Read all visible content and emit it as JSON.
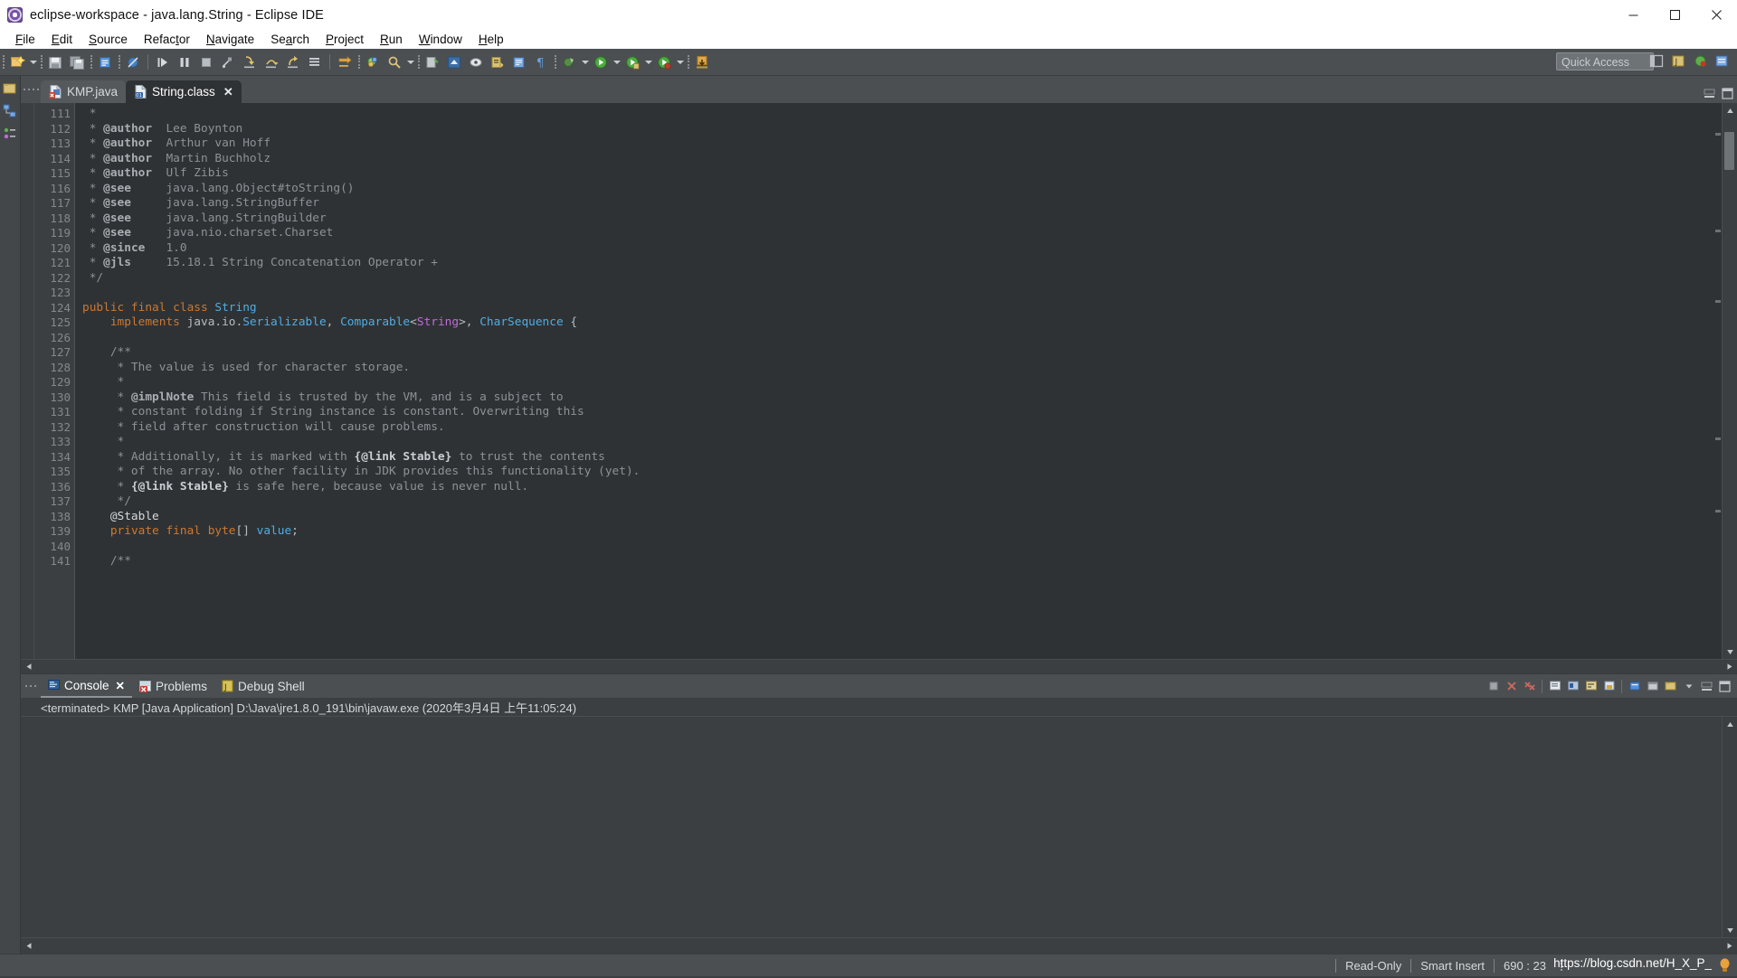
{
  "window": {
    "title": "eclipse-workspace - java.lang.String - Eclipse IDE",
    "app_icon": "eclipse-icon",
    "minimize": "minimize-icon",
    "maximize": "maximize-icon",
    "close": "close-icon"
  },
  "menu": {
    "items": [
      {
        "pre": "",
        "mn": "F",
        "post": "ile"
      },
      {
        "pre": "",
        "mn": "E",
        "post": "dit"
      },
      {
        "pre": "",
        "mn": "S",
        "post": "ource"
      },
      {
        "pre": "Refac",
        "mn": "t",
        "post": "or"
      },
      {
        "pre": "",
        "mn": "N",
        "post": "avigate"
      },
      {
        "pre": "Se",
        "mn": "a",
        "post": "rch"
      },
      {
        "pre": "",
        "mn": "P",
        "post": "roject"
      },
      {
        "pre": "",
        "mn": "R",
        "post": "un"
      },
      {
        "pre": "",
        "mn": "W",
        "post": "indow"
      },
      {
        "pre": "",
        "mn": "H",
        "post": "elp"
      }
    ]
  },
  "toolbar": {
    "quick_access_placeholder": "Quick Access",
    "buttons": [
      "new-wizard-icon",
      "new-dropdown-arrow",
      "save-icon",
      "save-all-icon",
      "new-java-class-icon",
      "toggle-breakpoint-icon",
      "resume-icon",
      "suspend-icon",
      "terminate-icon",
      "disconnect-icon",
      "step-into-icon",
      "step-over-icon",
      "step-return-icon",
      "use-step-filters-icon",
      "debug-perspective-icon",
      "open-type-icon",
      "search-icon",
      "last-edit-location-icon",
      "open-declaration-icon",
      "toggle-mark-occurrences-icon",
      "next-annotation-icon",
      "previous-annotation-icon",
      "back-icon",
      "forward-icon",
      "skip-breakpoints-icon",
      "external-tools-icon",
      "run-icon",
      "debug-icon",
      "coverage-icon",
      "download-icon"
    ],
    "perspective_buttons": [
      "open-perspective-icon",
      "java-perspective-icon",
      "debug-perspective-icon",
      "java-ee-perspective-icon"
    ]
  },
  "left_strip": {
    "icons": [
      "package-explorer-icon",
      "type-hierarchy-icon",
      "outline-icon"
    ]
  },
  "editor": {
    "tabs": [
      {
        "label": "KMP.java",
        "icon": "java-file-error-icon",
        "active": false,
        "closable": false
      },
      {
        "label": "String.class",
        "icon": "class-file-icon",
        "active": true,
        "closable": true,
        "close": "close-icon"
      }
    ],
    "minimize_icon": "minimize-view-icon",
    "maximize_icon": "maximize-view-icon",
    "first_line_number": 111,
    "lines": [
      {
        "num": "111",
        "fold": false,
        "tokens": [
          {
            "t": " *",
            "c": "cmt"
          }
        ]
      },
      {
        "num": "112",
        "fold": false,
        "tokens": [
          {
            "t": " * ",
            "c": "cmt"
          },
          {
            "t": "@author",
            "c": "cmt-tag"
          },
          {
            "t": "  Lee Boynton",
            "c": "cmt"
          }
        ]
      },
      {
        "num": "113",
        "fold": false,
        "tokens": [
          {
            "t": " * ",
            "c": "cmt"
          },
          {
            "t": "@author",
            "c": "cmt-tag"
          },
          {
            "t": "  Arthur van Hoff",
            "c": "cmt"
          }
        ]
      },
      {
        "num": "114",
        "fold": false,
        "tokens": [
          {
            "t": " * ",
            "c": "cmt"
          },
          {
            "t": "@author",
            "c": "cmt-tag"
          },
          {
            "t": "  Martin Buchholz",
            "c": "cmt"
          }
        ]
      },
      {
        "num": "115",
        "fold": false,
        "tokens": [
          {
            "t": " * ",
            "c": "cmt"
          },
          {
            "t": "@author",
            "c": "cmt-tag"
          },
          {
            "t": "  Ulf Zibis",
            "c": "cmt"
          }
        ]
      },
      {
        "num": "116",
        "fold": false,
        "tokens": [
          {
            "t": " * ",
            "c": "cmt"
          },
          {
            "t": "@see",
            "c": "cmt-tag"
          },
          {
            "t": "     java.lang.Object#toString()",
            "c": "cmt"
          }
        ]
      },
      {
        "num": "117",
        "fold": false,
        "tokens": [
          {
            "t": " * ",
            "c": "cmt"
          },
          {
            "t": "@see",
            "c": "cmt-tag"
          },
          {
            "t": "     java.lang.StringBuffer",
            "c": "cmt"
          }
        ]
      },
      {
        "num": "118",
        "fold": false,
        "tokens": [
          {
            "t": " * ",
            "c": "cmt"
          },
          {
            "t": "@see",
            "c": "cmt-tag"
          },
          {
            "t": "     java.lang.StringBuilder",
            "c": "cmt"
          }
        ]
      },
      {
        "num": "119",
        "fold": false,
        "tokens": [
          {
            "t": " * ",
            "c": "cmt"
          },
          {
            "t": "@see",
            "c": "cmt-tag"
          },
          {
            "t": "     java.nio.charset.Charset",
            "c": "cmt"
          }
        ]
      },
      {
        "num": "120",
        "fold": false,
        "tokens": [
          {
            "t": " * ",
            "c": "cmt"
          },
          {
            "t": "@since",
            "c": "cmt-tag"
          },
          {
            "t": "   1.0",
            "c": "cmt"
          }
        ]
      },
      {
        "num": "121",
        "fold": false,
        "tokens": [
          {
            "t": " * ",
            "c": "cmt"
          },
          {
            "t": "@jls",
            "c": "cmt-tag"
          },
          {
            "t": "     15.18.1 String Concatenation Operator +",
            "c": "cmt"
          }
        ]
      },
      {
        "num": "122",
        "fold": false,
        "tokens": [
          {
            "t": " */",
            "c": "cmt"
          }
        ]
      },
      {
        "num": "123",
        "fold": false,
        "tokens": []
      },
      {
        "num": "124",
        "fold": false,
        "tokens": [
          {
            "t": "public final class ",
            "c": "kw"
          },
          {
            "t": "String",
            "c": "typ"
          }
        ]
      },
      {
        "num": "125",
        "fold": false,
        "tokens": [
          {
            "t": "    ",
            "c": "plain"
          },
          {
            "t": "implements",
            "c": "kw"
          },
          {
            "t": " java.io.",
            "c": "plain"
          },
          {
            "t": "Serializable",
            "c": "typ"
          },
          {
            "t": ", ",
            "c": "plain"
          },
          {
            "t": "Comparable",
            "c": "typ"
          },
          {
            "t": "<",
            "c": "plain"
          },
          {
            "t": "String",
            "c": "gen"
          },
          {
            "t": ">, ",
            "c": "plain"
          },
          {
            "t": "CharSequence",
            "c": "typ"
          },
          {
            "t": " {",
            "c": "plain"
          }
        ]
      },
      {
        "num": "126",
        "fold": false,
        "tokens": []
      },
      {
        "num": "127",
        "fold": true,
        "tokens": [
          {
            "t": "    /**",
            "c": "cmt"
          }
        ]
      },
      {
        "num": "128",
        "fold": false,
        "tokens": [
          {
            "t": "     * The value is used for character storage.",
            "c": "cmt"
          }
        ]
      },
      {
        "num": "129",
        "fold": false,
        "tokens": [
          {
            "t": "     *",
            "c": "cmt"
          }
        ]
      },
      {
        "num": "130",
        "fold": false,
        "tokens": [
          {
            "t": "     * ",
            "c": "cmt"
          },
          {
            "t": "@implNote",
            "c": "cmt-tag"
          },
          {
            "t": " This field is trusted by the VM, and is a subject to",
            "c": "cmt"
          }
        ]
      },
      {
        "num": "131",
        "fold": false,
        "tokens": [
          {
            "t": "     * constant folding if String instance is constant. Overwriting this",
            "c": "cmt"
          }
        ]
      },
      {
        "num": "132",
        "fold": false,
        "tokens": [
          {
            "t": "     * field after construction will cause problems.",
            "c": "cmt"
          }
        ]
      },
      {
        "num": "133",
        "fold": false,
        "tokens": [
          {
            "t": "     *",
            "c": "cmt"
          }
        ]
      },
      {
        "num": "134",
        "fold": false,
        "tokens": [
          {
            "t": "     * Additionally, it is marked with ",
            "c": "cmt"
          },
          {
            "t": "{@link Stable}",
            "c": "cmt-link"
          },
          {
            "t": " to trust the contents",
            "c": "cmt"
          }
        ]
      },
      {
        "num": "135",
        "fold": false,
        "tokens": [
          {
            "t": "     * of the array. No other facility in JDK provides this functionality (yet).",
            "c": "cmt"
          }
        ]
      },
      {
        "num": "136",
        "fold": false,
        "tokens": [
          {
            "t": "     * ",
            "c": "cmt"
          },
          {
            "t": "{@link Stable}",
            "c": "cmt-link"
          },
          {
            "t": " is safe here, because value is never null.",
            "c": "cmt"
          }
        ]
      },
      {
        "num": "137",
        "fold": false,
        "tokens": [
          {
            "t": "     */",
            "c": "cmt"
          }
        ]
      },
      {
        "num": "138",
        "fold": true,
        "tokens": [
          {
            "t": "    @Stable",
            "c": "anno"
          }
        ]
      },
      {
        "num": "139",
        "fold": false,
        "tokens": [
          {
            "t": "    ",
            "c": "plain"
          },
          {
            "t": "private final byte",
            "c": "kw"
          },
          {
            "t": "[] ",
            "c": "plain"
          },
          {
            "t": "value",
            "c": "fld"
          },
          {
            "t": ";",
            "c": "plain"
          }
        ]
      },
      {
        "num": "140",
        "fold": false,
        "tokens": []
      },
      {
        "num": "141",
        "fold": false,
        "tokens": [
          {
            "t": "    /**",
            "c": "cmt"
          }
        ]
      }
    ]
  },
  "console": {
    "tabs": [
      {
        "label": "Console",
        "icon": "console-icon",
        "active": true,
        "closable": true,
        "close": "close-icon"
      },
      {
        "label": "Problems",
        "icon": "problems-icon",
        "active": false,
        "closable": false
      },
      {
        "label": "Debug Shell",
        "icon": "debug-shell-icon",
        "active": false,
        "closable": false
      }
    ],
    "launch_line": "<terminated> KMP [Java Application] D:\\Java\\jre1.8.0_191\\bin\\javaw.exe (2020年3月4日 上午11:05:24)",
    "output": "",
    "tools": [
      "terminate-icon",
      "remove-launch-icon",
      "remove-all-terminated-icon",
      "open-console-icon",
      "display-selected-console-icon",
      "word-wrap-icon",
      "scroll-lock-icon",
      "pin-console-icon",
      "clear-console-icon",
      "new-console-view-icon",
      "view-menu-icon",
      "minimize-view-icon",
      "maximize-view-icon"
    ]
  },
  "status_bar": {
    "read_only": "Read-Only",
    "insert_mode": "Smart Insert",
    "cursor_position": "690 : 23",
    "watermark": "https://blog.csdn.net/H_X_P_",
    "watermark_badge": "csdn-badge-icon"
  },
  "colors": {
    "editor_bg": "#2f3234",
    "chrome_bg": "#4b4f52",
    "gutter_bg": "#3c3f41",
    "keyword": "#cc7832",
    "type": "#4eade5",
    "generic": "#c06bd8",
    "comment": "#8c9296",
    "titlebar_bg": "#ffffff"
  }
}
